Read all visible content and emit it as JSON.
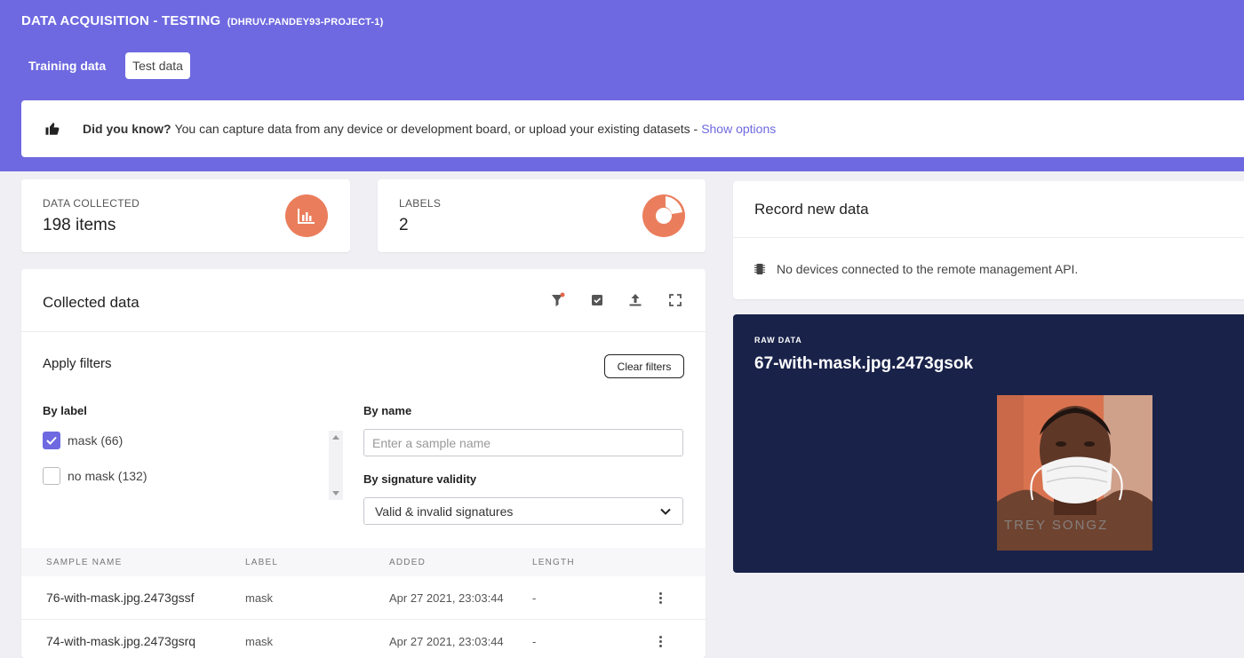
{
  "header": {
    "title": "DATA ACQUISITION - TESTING",
    "project": "(DHRUV.PANDEY93-PROJECT-1)",
    "tabs": [
      {
        "label": "Training data",
        "active": false
      },
      {
        "label": "Test data",
        "active": true
      }
    ]
  },
  "banner": {
    "icon": "thumbs-up-icon",
    "bold": "Did you know?",
    "text": "You can capture data from any device or development board, or upload your existing datasets -",
    "link": "Show options"
  },
  "stats": {
    "data_collected": {
      "label": "DATA COLLECTED",
      "value": "198 items",
      "icon": "bar-chart-icon"
    },
    "labels": {
      "label": "LABELS",
      "value": "2",
      "icon": "pie-chart-icon"
    }
  },
  "collected": {
    "title": "Collected data",
    "tools": [
      "filter-icon",
      "select-check-icon",
      "upload-icon",
      "expand-icon"
    ],
    "filters_title": "Apply filters",
    "clear_filters": "Clear filters",
    "by_label": "By label",
    "label_options": [
      {
        "label": "mask (66)",
        "checked": true
      },
      {
        "label": "no mask (132)",
        "checked": false
      }
    ],
    "by_name": "By name",
    "name_placeholder": "Enter a sample name",
    "by_signature": "By signature validity",
    "signature_value": "Valid & invalid signatures",
    "columns": [
      "SAMPLE NAME",
      "LABEL",
      "ADDED",
      "LENGTH"
    ],
    "rows": [
      {
        "name": "76-with-mask.jpg.2473gssf",
        "label": "mask",
        "added": "Apr 27 2021, 23:03:44",
        "length": "-"
      },
      {
        "name": "74-with-mask.jpg.2473gsrq",
        "label": "mask",
        "added": "Apr 27 2021, 23:03:44",
        "length": "-"
      }
    ]
  },
  "record": {
    "title": "Record new data",
    "message": "No devices connected to the remote management API."
  },
  "raw": {
    "label": "RAW DATA",
    "name": "67-with-mask.jpg.2473gsok",
    "image_caption": "TREY SONGZ"
  },
  "colors": {
    "accent": "#6e69e0",
    "orange": "#ea7e5c",
    "navy": "#192249"
  }
}
